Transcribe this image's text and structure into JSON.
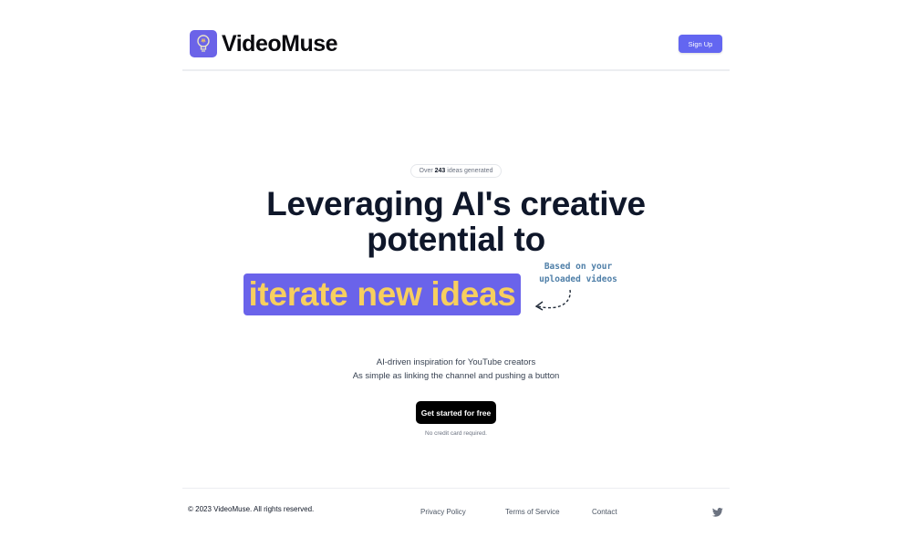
{
  "header": {
    "brand": "VideoMuse",
    "signup_label": "Sign Up"
  },
  "hero": {
    "badge_prefix": "Over",
    "badge_count": "243",
    "badge_suffix": "ideas generated",
    "headline": "Leveraging AI's creative potential to",
    "highlight": "iterate new ideas",
    "annotation_line1": "Based on your",
    "annotation_line2": "uploaded videos",
    "sub_line1": "AI-driven inspiration for YouTube creators",
    "sub_line2": "As simple as linking the channel and pushing a button",
    "cta_label": "Get started for free",
    "note": "No credit card required."
  },
  "footer": {
    "copyright": "© 2023 VideoMuse. All rights reserved.",
    "links": [
      "Privacy Policy",
      "Terms of Service",
      "Contact"
    ],
    "social_icon": "twitter-icon"
  },
  "colors": {
    "brand_purple": "#6366f1",
    "highlight_bg": "#6a63ea",
    "highlight_text": "#f7cf5e",
    "annotation": "#4f7fa8"
  }
}
